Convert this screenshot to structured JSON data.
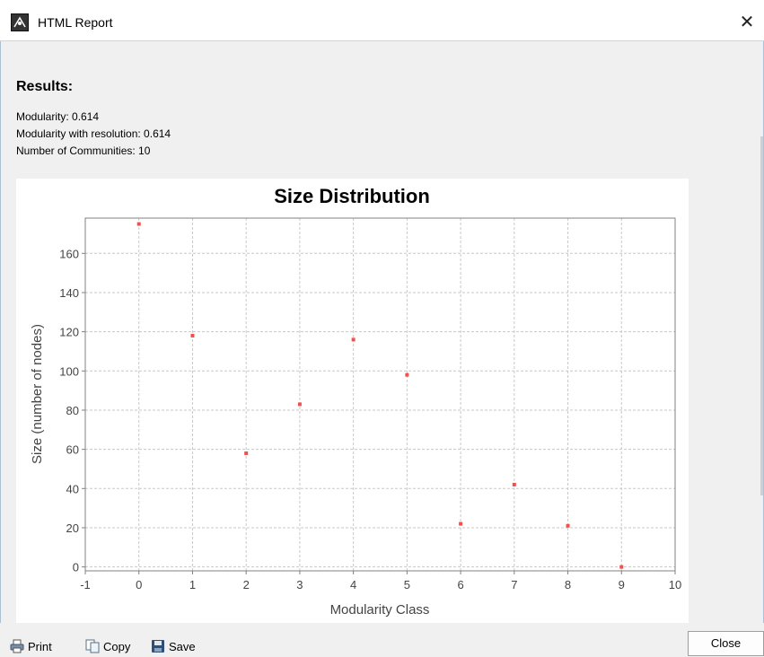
{
  "window": {
    "title": "HTML Report",
    "close_glyph": "✕"
  },
  "report": {
    "heading": "Results:",
    "stats": [
      "Modularity: 0.614",
      "Modularity with resolution: 0.614",
      "Number of Communities: 10"
    ]
  },
  "chart_data": {
    "type": "scatter",
    "title": "Size Distribution",
    "xlabel": "Modularity Class",
    "ylabel": "Size (number of nodes)",
    "xlim": [
      -1,
      10
    ],
    "ylim": [
      -2,
      178
    ],
    "xticks": [
      "-1",
      "0",
      "1",
      "2",
      "3",
      "4",
      "5",
      "6",
      "7",
      "8",
      "9",
      "10"
    ],
    "yticks": [
      "0",
      "20",
      "40",
      "60",
      "80",
      "100",
      "120",
      "140",
      "160"
    ],
    "grid": true,
    "marker_color": "#f25050",
    "x": [
      0,
      1,
      2,
      3,
      4,
      5,
      6,
      7,
      8,
      9
    ],
    "y": [
      175,
      118,
      58,
      83,
      116,
      98,
      22,
      42,
      21,
      0
    ]
  },
  "toolbar": {
    "print_label": "Print",
    "copy_label": "Copy",
    "save_label": "Save",
    "close_label": "Close"
  }
}
